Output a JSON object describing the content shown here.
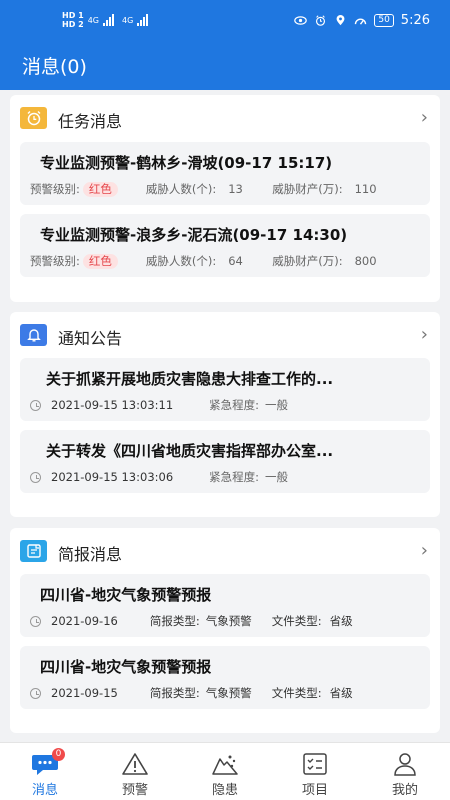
{
  "status_bar": {
    "hd1": "HD 1",
    "hd2": "HD 2",
    "net1": "4G",
    "net2": "4G",
    "battery": "50",
    "time": "5:26"
  },
  "header": {
    "title": "消息(0)"
  },
  "colors": {
    "primary": "#1f77e0",
    "tag_red": "#e5484d",
    "badge": "#f04b4b"
  },
  "task_section": {
    "title": "任务消息",
    "icon": "alarm-clock-icon",
    "items": [
      {
        "title": "专业监测预警-鹤林乡-滑坡(09-17 15:17)",
        "level_label": "预警级别:",
        "level": "红色",
        "people_label": "威胁人数(个):",
        "people": "13",
        "property_label": "威胁财产(万):",
        "property": "110"
      },
      {
        "title": "专业监测预警-浪多乡-泥石流(09-17 14:30)",
        "level_label": "预警级别:",
        "level": "红色",
        "people_label": "威胁人数(个):",
        "people": "64",
        "property_label": "威胁财产(万):",
        "property": "800"
      }
    ]
  },
  "notice_section": {
    "title": "通知公告",
    "icon": "bell-icon",
    "items": [
      {
        "title": "关于抓紧开展地质灾害隐患大排查工作的...",
        "time": "2021-09-15 13:03:11",
        "urgency_label": "紧急程度:",
        "urgency": "一般"
      },
      {
        "title": "关于转发《四川省地质灾害指挥部办公室...",
        "time": "2021-09-15 13:03:06",
        "urgency_label": "紧急程度:",
        "urgency": "一般"
      }
    ]
  },
  "brief_section": {
    "title": "简报消息",
    "icon": "report-icon",
    "items": [
      {
        "title": "四川省-地灾气象预警预报",
        "date": "2021-09-16",
        "type_label": "简报类型:",
        "type": "气象预警",
        "file_label": "文件类型:",
        "file": "省级"
      },
      {
        "title": "四川省-地灾气象预警预报",
        "date": "2021-09-15",
        "type_label": "简报类型:",
        "type": "气象预警",
        "file_label": "文件类型:",
        "file": "省级"
      }
    ]
  },
  "tabbar": {
    "badge": "0",
    "tabs": [
      {
        "label": "消息",
        "icon": "message-icon",
        "active": true
      },
      {
        "label": "预警",
        "icon": "warning-icon"
      },
      {
        "label": "隐患",
        "icon": "hazard-icon"
      },
      {
        "label": "项目",
        "icon": "project-icon"
      },
      {
        "label": "我的",
        "icon": "user-icon"
      }
    ]
  }
}
